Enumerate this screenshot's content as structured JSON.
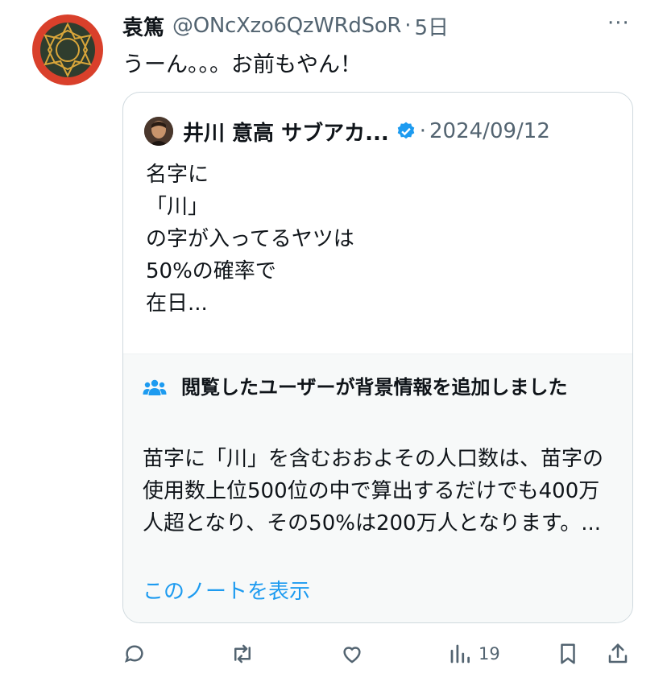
{
  "post": {
    "display_name": "袁篤",
    "handle": "@ONcXzo6QzWRdSoR",
    "separator": "·",
    "time": "5日",
    "more": "···",
    "text": "うーん。。。お前もやん！"
  },
  "quote": {
    "display_name": "井川 意高 サブアカ...",
    "separator": "·",
    "time": "2024/09/12",
    "lines": [
      "名字に",
      "「川」",
      "の字が入ってるヤツは",
      "50%の確率で",
      "在日..."
    ]
  },
  "community_note": {
    "title": "閲覧したユーザーが背景情報を追加しました",
    "body": "苗字に「川」を含むおおよその人口数は、苗字の使用数上位500位の中で算出するだけでも400万人超となり、その50%は200万人となります。...",
    "link": "このノートを表示"
  },
  "actions": {
    "views": "19",
    "icons": [
      "reply-icon",
      "retweet-icon",
      "like-icon",
      "views-icon",
      "bookmark-icon",
      "share-icon"
    ]
  },
  "colors": {
    "accent": "#1d9bf0",
    "secondary_text": "#536471",
    "border": "#cfd9de",
    "note_background": "#f7f9f9",
    "avatar_background": "#d9402b"
  }
}
